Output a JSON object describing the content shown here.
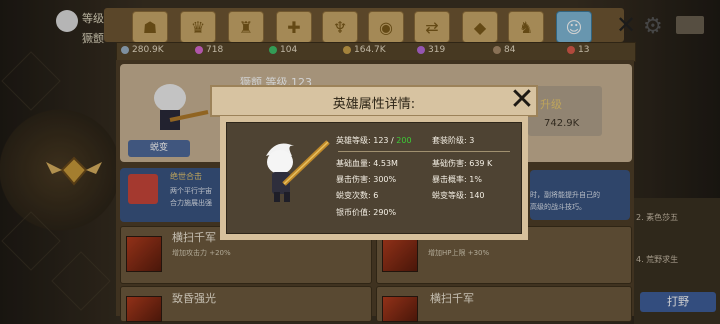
{
  "left_panel": {
    "name": "等级",
    "sub": "獗颤"
  },
  "resources": [
    {
      "icon": "silver-coin-icon",
      "value": "280.9K",
      "color": "#9ab0c4"
    },
    {
      "icon": "pink-gem-icon",
      "value": "718",
      "color": "#d86ad0"
    },
    {
      "icon": "green-orb-icon",
      "value": "104",
      "color": "#3fbf6a"
    },
    {
      "icon": "sword-icon",
      "value": "164.7K",
      "color": "#c8a04a"
    },
    {
      "icon": "purple-gem-icon",
      "value": "319",
      "color": "#b66ad8"
    },
    {
      "icon": "feather-icon",
      "value": "84",
      "color": "#a88a6a"
    },
    {
      "icon": "red-shield-icon",
      "value": "13",
      "color": "#d85a4a"
    }
  ],
  "tabs": [
    {
      "name": "hero-tab",
      "glyph": "☗"
    },
    {
      "name": "crown-tab",
      "glyph": "♛"
    },
    {
      "name": "castle-tab",
      "glyph": "♜"
    },
    {
      "name": "plus-tab",
      "glyph": "✚"
    },
    {
      "name": "trophy-tab",
      "glyph": "♆"
    },
    {
      "name": "orb-tab",
      "glyph": "◉"
    },
    {
      "name": "scroll-tab",
      "glyph": "⇄"
    },
    {
      "name": "diamond-tab",
      "glyph": "◆"
    },
    {
      "name": "shirt-tab",
      "glyph": "♞"
    },
    {
      "name": "group-tab",
      "glyph": "☺"
    }
  ],
  "hero_card": {
    "name": "獗颤 等级.123",
    "transform_button": "蜕变",
    "upgrade_label": "升级",
    "upgrade_value": "742.9K"
  },
  "skills": {
    "blue_title": "绝世合击",
    "blue_desc1": "两个平行宇宙",
    "blue_desc2": "合力施展出强",
    "blue_right1": "时，副将能提升自己的",
    "blue_right2": "高级的战斗技巧。",
    "s1_name": "横扫千军",
    "s1_sub": "增加攻击力 +20%",
    "s2_sub": "增加HP上限 +30%",
    "s3_name": "致昏强光",
    "s4_name": "横扫千军"
  },
  "side": {
    "item1": "2. 素色莎五",
    "item2": "4. 荒野求生",
    "hunt_button": "打野"
  },
  "dialog": {
    "title": "英雄属性详情:",
    "hero_level_label": "英雄等级: 123 / ",
    "hero_level_max": "200",
    "set_level": "套装阶级: 3",
    "base_hp": "基础血量: 4.53M",
    "base_dmg": "基础伤害: 639 K",
    "crit_dmg": "暴击伤害: 300%",
    "crit_rate": "暴击概率: 1%",
    "transform_count": "蜕变次数: 6",
    "transform_level": "蜕变等级: 140",
    "coin_value": "银币价值: 290%"
  }
}
